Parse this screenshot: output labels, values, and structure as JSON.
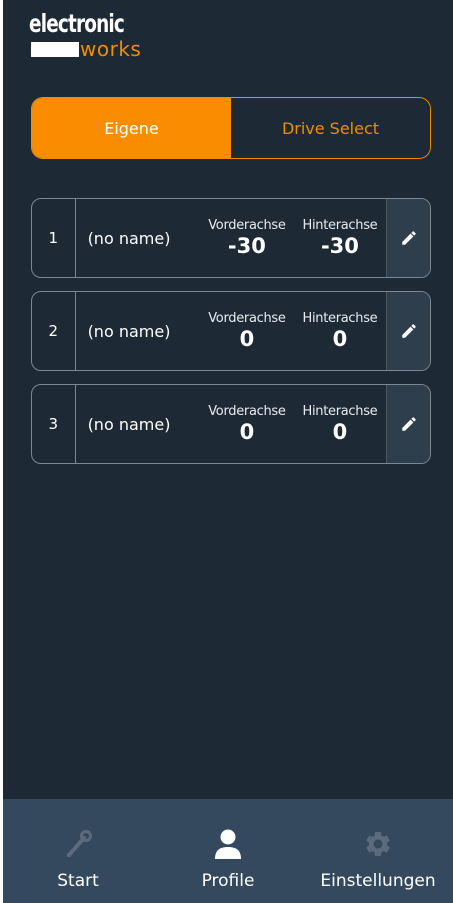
{
  "brand": {
    "line1": "electronic",
    "line2": "works"
  },
  "tabs": [
    {
      "label": "Eigene",
      "active": true
    },
    {
      "label": "Drive Select",
      "active": false
    }
  ],
  "profiles": [
    {
      "number": "1",
      "name": "(no name)",
      "front_label": "Vorderachse",
      "front_value": "-30",
      "rear_label": "Hinterachse",
      "rear_value": "-30",
      "edit_icon": "pencil-icon"
    },
    {
      "number": "2",
      "name": "(no name)",
      "front_label": "Vorderachse",
      "front_value": "0",
      "rear_label": "Hinterachse",
      "rear_value": "0",
      "edit_icon": "pencil-icon"
    },
    {
      "number": "3",
      "name": "(no name)",
      "front_label": "Vorderachse",
      "front_value": "0",
      "rear_label": "Hinterachse",
      "rear_value": "0",
      "edit_icon": "pencil-icon"
    }
  ],
  "bottom_nav": [
    {
      "label": "Start",
      "icon": "wrench-icon",
      "active": false
    },
    {
      "label": "Profile",
      "icon": "user-icon",
      "active": true
    },
    {
      "label": "Einstellungen",
      "icon": "gear-icon",
      "active": false
    }
  ],
  "colors": {
    "background": "#1d2a36",
    "accent": "#f98c00",
    "nav_background": "#34495e",
    "inactive_icon": "#5b6b7c"
  }
}
